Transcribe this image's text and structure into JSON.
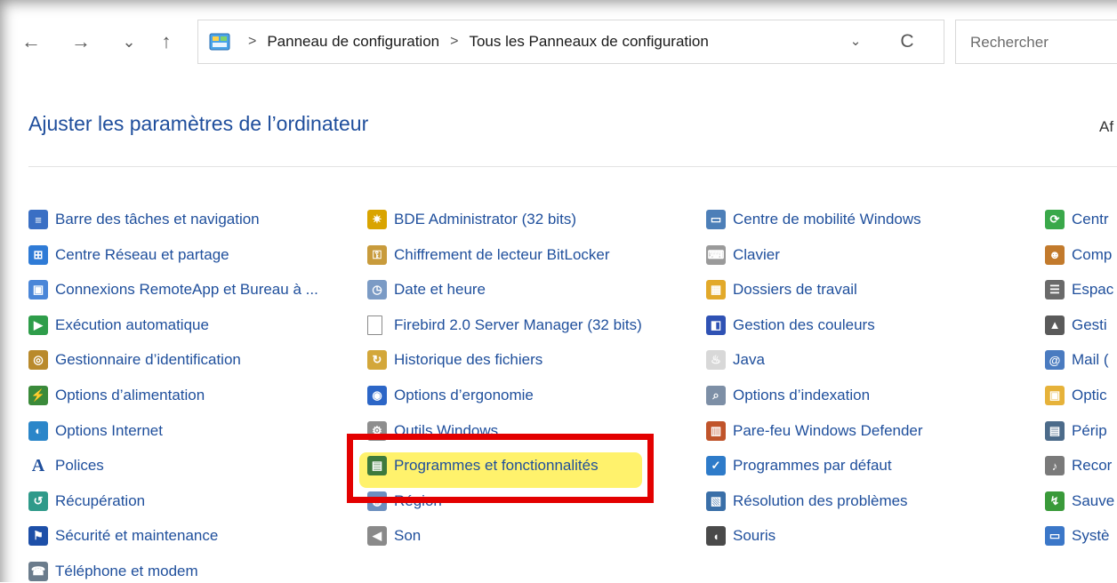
{
  "toolbar": {
    "back_icon": "←",
    "forward_icon": "→",
    "recent_icon": "⌄",
    "up_icon": "↑",
    "breadcrumb": [
      "Panneau de configuration",
      "Tous les Panneaux de configuration"
    ],
    "breadcrumb_sep": ">",
    "dropdown_icon": "⌄",
    "refresh_icon": "C",
    "search_placeholder": "Rechercher"
  },
  "header": {
    "title": "Ajuster les paramètres de l’ordinateur",
    "view_by_clip": "Af"
  },
  "items": {
    "col1": [
      {
        "label": "Barre des tâches et navigation",
        "icon": "taskbar-icon",
        "color": "#3a6fc4",
        "glyph": "≡"
      },
      {
        "label": "Centre Réseau et partage",
        "icon": "network-icon",
        "color": "#2f7bd6",
        "glyph": "⊞"
      },
      {
        "label": "Connexions RemoteApp et Bureau à ...",
        "icon": "remoteapp-icon",
        "color": "#4a86d8",
        "glyph": "▣"
      },
      {
        "label": "Exécution automatique",
        "icon": "autoplay-icon",
        "color": "#2e9d4a",
        "glyph": "▶"
      },
      {
        "label": "Gestionnaire d’identification",
        "icon": "credential-icon",
        "color": "#b98a2c",
        "glyph": "◎"
      },
      {
        "label": "Options d’alimentation",
        "icon": "power-icon",
        "color": "#3a8a3a",
        "glyph": "⚡"
      },
      {
        "label": "Options Internet",
        "icon": "internet-icon",
        "color": "#2b86c9",
        "glyph": "◐"
      },
      {
        "label": "Polices",
        "icon": "fonts-icon",
        "color": "#f4c430",
        "glyph": "A"
      },
      {
        "label": "Récupération",
        "icon": "recovery-icon",
        "color": "#2f9a8a",
        "glyph": "↺"
      },
      {
        "label": "Sécurité et maintenance",
        "icon": "flag-icon",
        "color": "#1d4fa8",
        "glyph": "⚑"
      },
      {
        "label": "Téléphone et modem",
        "icon": "phone-icon",
        "color": "#6b7c8c",
        "glyph": "☎"
      }
    ],
    "col2": [
      {
        "label": "BDE Administrator (32 bits)",
        "icon": "bde-icon",
        "color": "#d9a400",
        "glyph": "✷"
      },
      {
        "label": "Chiffrement de lecteur BitLocker",
        "icon": "bitlocker-icon",
        "color": "#c89b3c",
        "glyph": "⚿"
      },
      {
        "label": "Date et heure",
        "icon": "clock-icon",
        "color": "#7b9bc5",
        "glyph": "◷"
      },
      {
        "label": "Firebird 2.0 Server Manager (32 bits)",
        "icon": "file-icon",
        "color": "#ffffff",
        "glyph": ""
      },
      {
        "label": "Historique des fichiers",
        "icon": "file-history-icon",
        "color": "#d3a73a",
        "glyph": "↻"
      },
      {
        "label": "Options d’ergonomie",
        "icon": "ease-of-access-icon",
        "color": "#2c66c7",
        "glyph": "◉"
      },
      {
        "label": "Outils Windows",
        "icon": "tools-icon",
        "color": "#8e8e8e",
        "glyph": "⚙"
      },
      {
        "label": "Programmes et fonctionnalités",
        "icon": "programs-icon",
        "color": "#3d7a3d",
        "glyph": "▤"
      },
      {
        "label": "Région",
        "icon": "region-icon",
        "color": "#6c8fbf",
        "glyph": "◍"
      },
      {
        "label": "Son",
        "icon": "speaker-icon",
        "color": "#8a8a8a",
        "glyph": "◀"
      }
    ],
    "col3": [
      {
        "label": "Centre de mobilité Windows",
        "icon": "mobility-icon",
        "color": "#4d7fb8",
        "glyph": "▭"
      },
      {
        "label": "Clavier",
        "icon": "keyboard-icon",
        "color": "#9a9a9a",
        "glyph": "⌨"
      },
      {
        "label": "Dossiers de travail",
        "icon": "work-folders-icon",
        "color": "#e2a92a",
        "glyph": "▦"
      },
      {
        "label": "Gestion des couleurs",
        "icon": "color-management-icon",
        "color": "#2f52b4",
        "glyph": "◧"
      },
      {
        "label": "Java",
        "icon": "java-icon",
        "color": "#d8d8d8",
        "glyph": "♨"
      },
      {
        "label": "Options d’indexation",
        "icon": "indexing-icon",
        "color": "#7d8fa6",
        "glyph": "⌕"
      },
      {
        "label": "Pare-feu Windows Defender",
        "icon": "firewall-icon",
        "color": "#c0542b",
        "glyph": "▥"
      },
      {
        "label": "Programmes par défaut",
        "icon": "default-programs-icon",
        "color": "#2e7bc9",
        "glyph": "✓"
      },
      {
        "label": "Résolution des problèmes",
        "icon": "troubleshoot-icon",
        "color": "#3a6fa8",
        "glyph": "▧"
      },
      {
        "label": "Souris",
        "icon": "mouse-icon",
        "color": "#4a4a4a",
        "glyph": "◖"
      }
    ],
    "col4": [
      {
        "label": "Centr",
        "icon": "sync-center-icon",
        "color": "#3aa84a",
        "glyph": "⟳"
      },
      {
        "label": "Comp",
        "icon": "user-accounts-icon",
        "color": "#c27a2c",
        "glyph": "☻"
      },
      {
        "label": "Espac",
        "icon": "storage-spaces-icon",
        "color": "#6a6a6a",
        "glyph": "☰"
      },
      {
        "label": "Gesti",
        "icon": "device-manager-icon",
        "color": "#5a5a5a",
        "glyph": "▲"
      },
      {
        "label": "Mail (",
        "icon": "mail-icon",
        "color": "#4a7bc0",
        "glyph": "@"
      },
      {
        "label": "Optic",
        "icon": "folder-options-icon",
        "color": "#e6b23a",
        "glyph": "▣"
      },
      {
        "label": "Périp",
        "icon": "devices-icon",
        "color": "#4c6b8a",
        "glyph": "▤"
      },
      {
        "label": "Recor",
        "icon": "microphone-icon",
        "color": "#7a7a7a",
        "glyph": "♪"
      },
      {
        "label": "Sauve",
        "icon": "backup-icon",
        "color": "#3a9a3a",
        "glyph": "↯"
      },
      {
        "label": "Systè",
        "icon": "system-icon",
        "color": "#3b77c8",
        "glyph": "▭"
      }
    ]
  }
}
